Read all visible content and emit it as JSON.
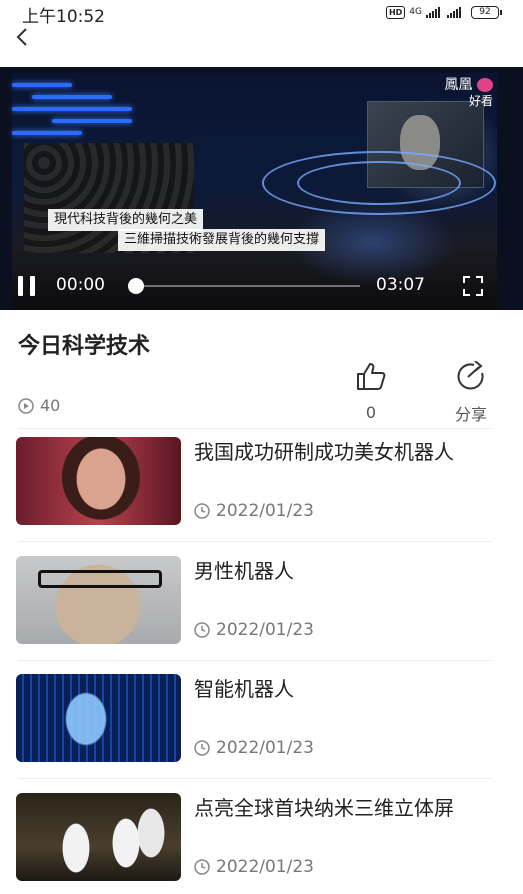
{
  "status_bar": {
    "time": "上午10:52",
    "hd": "HD",
    "network": "4G",
    "battery": "92"
  },
  "video": {
    "brand_line1": "鳳凰",
    "brand_line2": "好看",
    "caption_line1": "現代科技背後的幾何之美",
    "caption_line2": "三維掃描技術發展背後的幾何支撐",
    "current_time": "00:00",
    "duration": "03:07",
    "progress_fraction": 0
  },
  "article": {
    "title": "今日科学技术",
    "views": "40",
    "likes": "0",
    "share_label": "分享"
  },
  "related": [
    {
      "title": "我国成功研制成功美女机器人",
      "date": "2022/01/23",
      "thumb": "female-robot"
    },
    {
      "title": "男性机器人",
      "date": "2022/01/23",
      "thumb": "male-robot"
    },
    {
      "title": "智能机器人",
      "date": "2022/01/23",
      "thumb": "ai-head"
    },
    {
      "title": "点亮全球首块纳米三维立体屏",
      "date": "2022/01/23",
      "thumb": "lab-scientists"
    }
  ]
}
